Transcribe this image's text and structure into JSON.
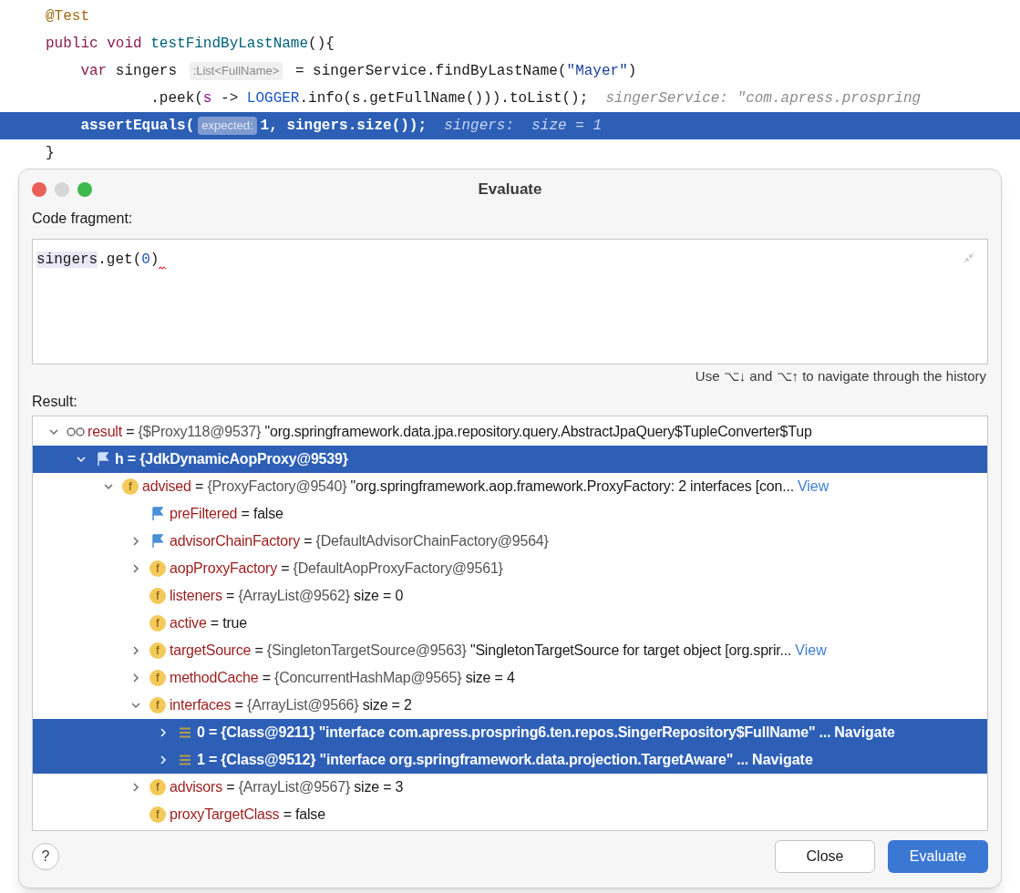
{
  "code_lines": [
    {
      "selected": false,
      "segments": [
        {
          "kind": "annotation",
          "text": "@Test"
        }
      ]
    },
    {
      "selected": false,
      "segments": [
        {
          "kind": "keyword",
          "text": "public void "
        },
        {
          "kind": "method",
          "text": "testFindByLastName"
        },
        {
          "kind": "plain",
          "text": "(){"
        }
      ]
    },
    {
      "selected": false,
      "segments": [
        {
          "kind": "keyword",
          "text": "    var"
        },
        {
          "kind": "plain",
          "text": " singers "
        },
        {
          "kind": "hint",
          "text": ":List<FullName>"
        },
        {
          "kind": "plain",
          "text": " = singerService.findByLastName("
        },
        {
          "kind": "string",
          "text": "\"Mayer\""
        },
        {
          "kind": "plain",
          "text": ")"
        }
      ]
    },
    {
      "selected": false,
      "segments": [
        {
          "kind": "plain",
          "text": "            .peek("
        },
        {
          "kind": "param",
          "text": "s"
        },
        {
          "kind": "plain",
          "text": " -> "
        },
        {
          "kind": "static",
          "text": "LOGGER"
        },
        {
          "kind": "plain",
          "text": ".info(s.getFullName())).toList();  "
        },
        {
          "kind": "debug",
          "text": "singerService: \"com.apress.prospring"
        }
      ]
    },
    {
      "selected": true,
      "segments": [
        {
          "kind": "plain",
          "text": "    assertEquals("
        },
        {
          "kind": "hint",
          "text": "expected:"
        },
        {
          "kind": "plain",
          "text": "1, singers.size());  "
        },
        {
          "kind": "debug",
          "text": "singers:  size = 1"
        }
      ]
    },
    {
      "selected": false,
      "segments": [
        {
          "kind": "plain",
          "text": "}"
        }
      ]
    }
  ],
  "dialog": {
    "title": "Evaluate",
    "code_fragment_label": "Code fragment:",
    "code_fragment": [
      {
        "kind": "variable",
        "text": "singers"
      },
      {
        "kind": "plain",
        "text": ".get("
      },
      {
        "kind": "number",
        "text": "0"
      },
      {
        "kind": "plain",
        "text": ")"
      }
    ],
    "history_hint": "Use ⌥↓ and ⌥↑ to navigate through the history",
    "result_label": "Result:",
    "tree": [
      {
        "kind": "value",
        "name": "result",
        "operator": "=",
        "type": "{$Proxy118@9537}",
        "value": "\"org.springframework.data.jpa.repository.query.AbstractJpaQuery$TupleConverter$Tup",
        "expanded": true,
        "selected": false,
        "children": [
          {
            "kind": "marker",
            "name": "h",
            "operator": "=",
            "type": "{JdkDynamicAopProxy@9539}",
            "expanded": true,
            "selected": true,
            "children": [
              {
                "kind": "field",
                "badge": "f",
                "name": "advised",
                "operator": "=",
                "type": "{ProxyFactory@9540}",
                "value": "\"org.springframework.aop.framework.ProxyFactory: 2 interfaces [con...",
                "link": "View",
                "expanded": true,
                "selected": false,
                "children": [
                  {
                    "kind": "marker",
                    "name": "preFiltered",
                    "operator": "=",
                    "value": "false",
                    "selected": false
                  },
                  {
                    "kind": "marker",
                    "name": "advisorChainFactory",
                    "operator": "=",
                    "type": "{DefaultAdvisorChainFactory@9564}",
                    "expanded": false,
                    "selected": false
                  },
                  {
                    "kind": "field",
                    "badge": "f",
                    "name": "aopProxyFactory",
                    "operator": "=",
                    "type": "{DefaultAopProxyFactory@9561}",
                    "expanded": false,
                    "selected": false
                  },
                  {
                    "kind": "field",
                    "badge": "f",
                    "name": "listeners",
                    "operator": "=",
                    "type": "{ArrayList@9562}",
                    "value": "size = 0",
                    "selected": false
                  },
                  {
                    "kind": "field",
                    "badge": "f",
                    "name": "active",
                    "operator": "=",
                    "value": "true",
                    "selected": false
                  },
                  {
                    "kind": "field",
                    "badge": "f",
                    "name": "targetSource",
                    "operator": "=",
                    "type": "{SingletonTargetSource@9563}",
                    "value": "\"SingletonTargetSource for target object [org.sprir...",
                    "link": "View",
                    "expanded": false,
                    "selected": false
                  },
                  {
                    "kind": "field",
                    "badge": "f",
                    "name": "methodCache",
                    "operator": "=",
                    "type": "{ConcurrentHashMap@9565}",
                    "value": "size = 4",
                    "expanded": false,
                    "selected": false
                  },
                  {
                    "kind": "field",
                    "badge": "f",
                    "name": "interfaces",
                    "operator": "=",
                    "type": "{ArrayList@9566}",
                    "value": "size = 2",
                    "expanded": true,
                    "selected": false,
                    "children": [
                      {
                        "kind": "element",
                        "name": "0",
                        "operator": "=",
                        "type": "{Class@9211}",
                        "value": "\"interface com.apress.prospring6.ten.repos.SingerRepository$FullName\" ...",
                        "link": "Navigate",
                        "expanded": false,
                        "selected": true
                      },
                      {
                        "kind": "element",
                        "name": "1",
                        "operator": "=",
                        "type": "{Class@9512}",
                        "value": "\"interface org.springframework.data.projection.TargetAware\" ...",
                        "link": "Navigate",
                        "expanded": false,
                        "selected": true
                      }
                    ]
                  },
                  {
                    "kind": "field",
                    "badge": "f",
                    "name": "advisors",
                    "operator": "=",
                    "type": "{ArrayList@9567}",
                    "value": "size = 3",
                    "expanded": false,
                    "selected": false
                  },
                  {
                    "kind": "field",
                    "badge": "f",
                    "name": "proxyTargetClass",
                    "operator": "=",
                    "value": "false",
                    "selected": false
                  }
                ]
              }
            ]
          }
        ]
      }
    ],
    "help": "?",
    "buttons": [
      {
        "kind": "secondary",
        "label": "Close"
      },
      {
        "kind": "primary",
        "label": "Evaluate"
      }
    ]
  }
}
